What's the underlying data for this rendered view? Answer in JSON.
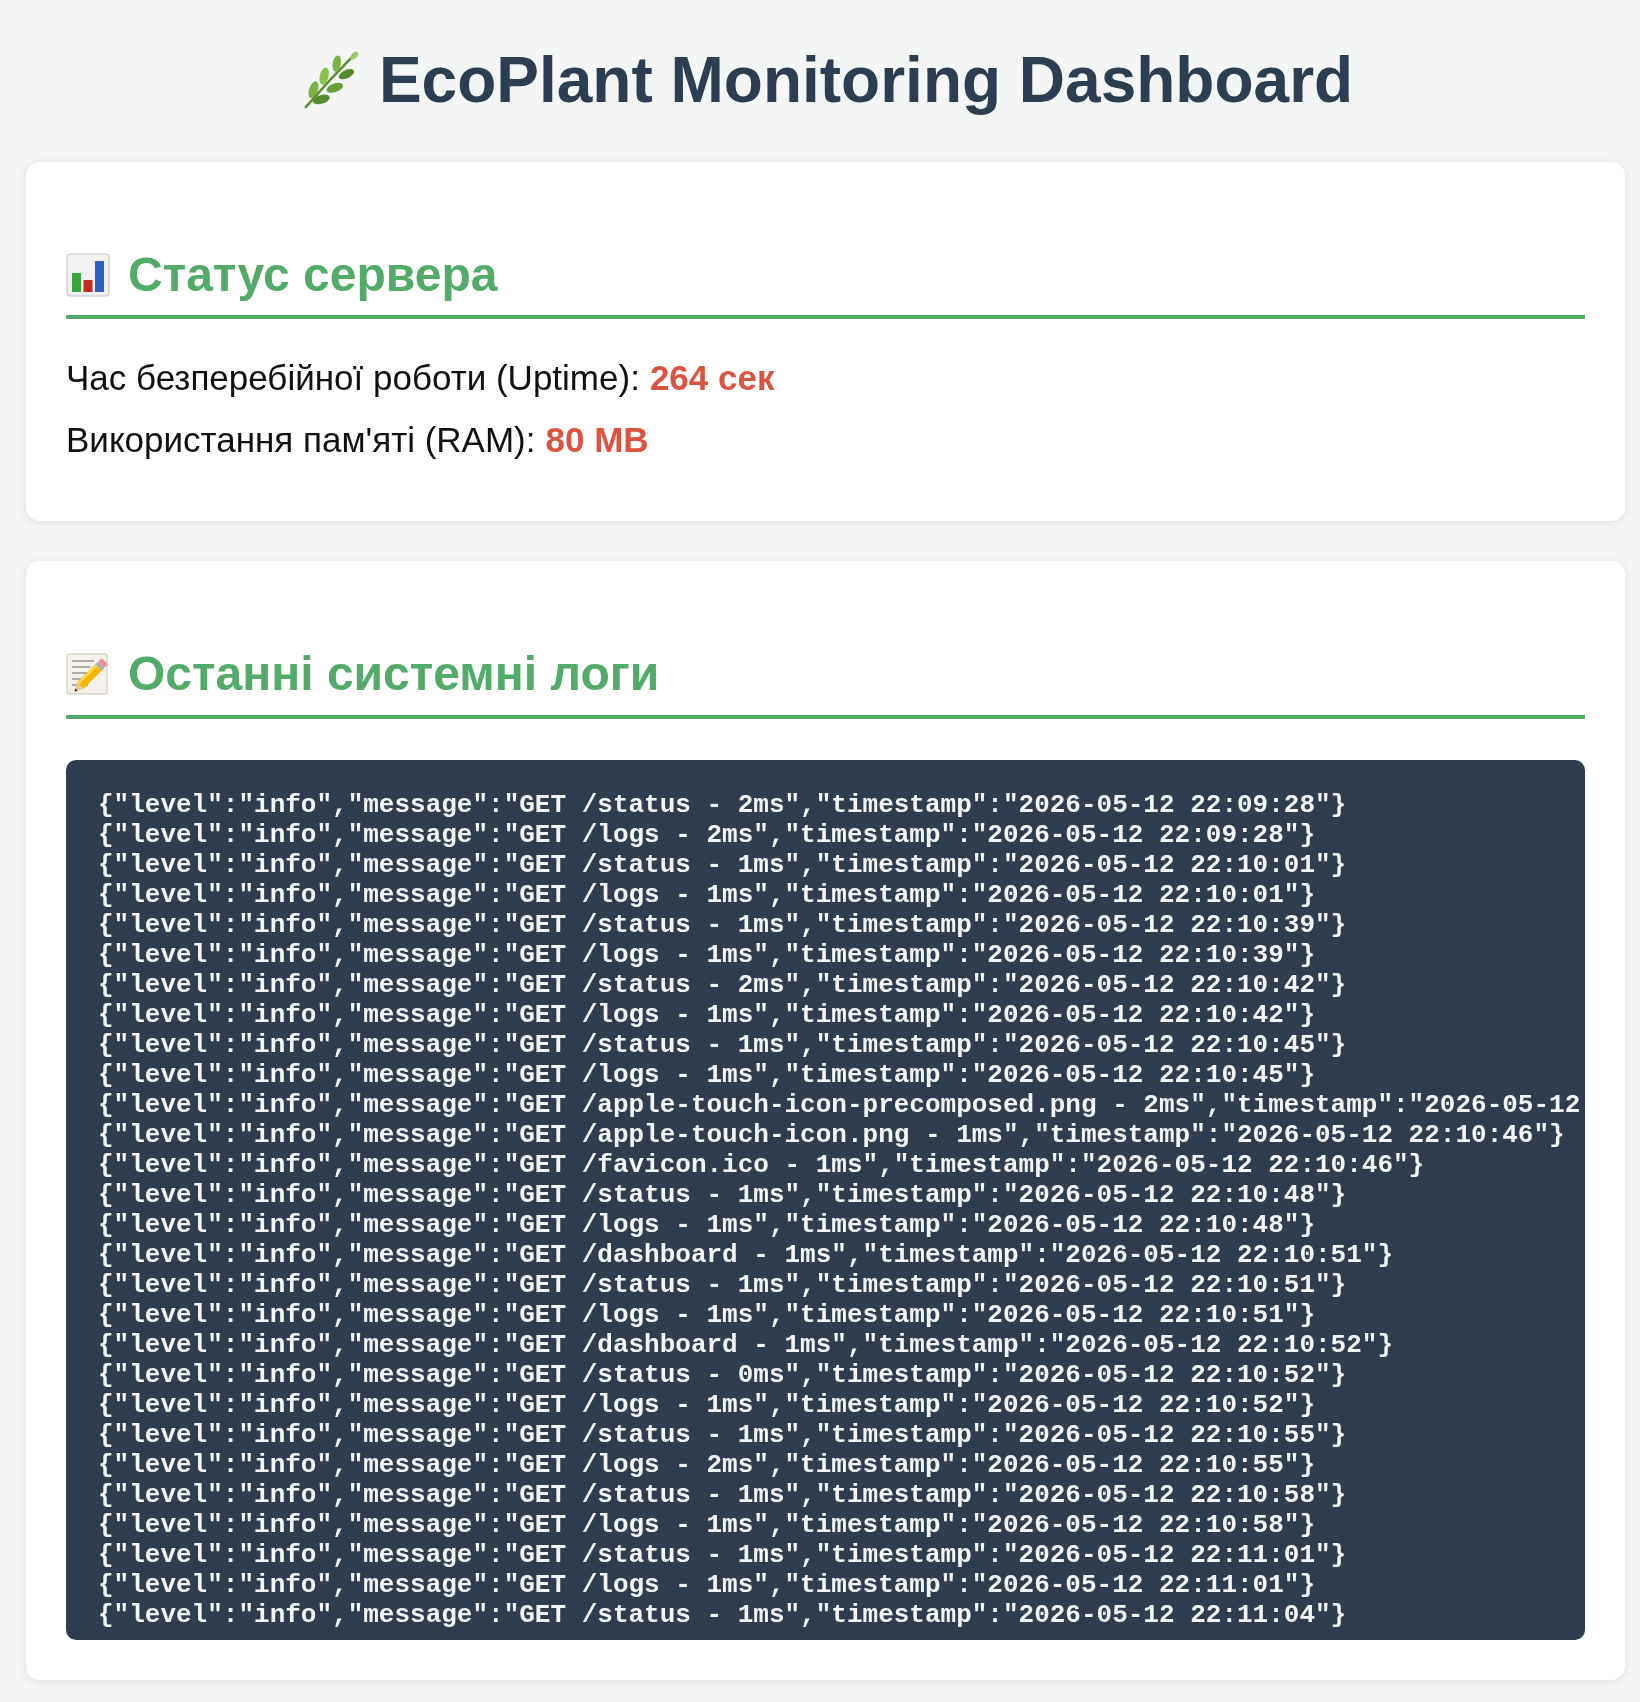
{
  "title": "EcoPlant Monitoring Dashboard",
  "sections": [
    {
      "kind": "metrics",
      "heading": "Статус сервера",
      "metrics": [
        {
          "label": "Час безперебійної роботи (Uptime):",
          "value": "264 сек"
        },
        {
          "label": "Використання пам'яті (RAM):",
          "value": "80 MB"
        }
      ]
    },
    {
      "kind": "log",
      "heading": "Останні системні логи",
      "lines": [
        "{\"level\":\"info\",\"message\":\"GET /status - 2ms\",\"timestamp\":\"2026-05-12 22:09:28\"}",
        "{\"level\":\"info\",\"message\":\"GET /logs - 2ms\",\"timestamp\":\"2026-05-12 22:09:28\"}",
        "{\"level\":\"info\",\"message\":\"GET /status - 1ms\",\"timestamp\":\"2026-05-12 22:10:01\"}",
        "{\"level\":\"info\",\"message\":\"GET /logs - 1ms\",\"timestamp\":\"2026-05-12 22:10:01\"}",
        "{\"level\":\"info\",\"message\":\"GET /status - 1ms\",\"timestamp\":\"2026-05-12 22:10:39\"}",
        "{\"level\":\"info\",\"message\":\"GET /logs - 1ms\",\"timestamp\":\"2026-05-12 22:10:39\"}",
        "{\"level\":\"info\",\"message\":\"GET /status - 2ms\",\"timestamp\":\"2026-05-12 22:10:42\"}",
        "{\"level\":\"info\",\"message\":\"GET /logs - 1ms\",\"timestamp\":\"2026-05-12 22:10:42\"}",
        "{\"level\":\"info\",\"message\":\"GET /status - 1ms\",\"timestamp\":\"2026-05-12 22:10:45\"}",
        "{\"level\":\"info\",\"message\":\"GET /logs - 1ms\",\"timestamp\":\"2026-05-12 22:10:45\"}",
        "{\"level\":\"info\",\"message\":\"GET /apple-touch-icon-precomposed.png - 2ms\",\"timestamp\":\"2026-05-12",
        "{\"level\":\"info\",\"message\":\"GET /apple-touch-icon.png - 1ms\",\"timestamp\":\"2026-05-12 22:10:46\"}",
        "{\"level\":\"info\",\"message\":\"GET /favicon.ico - 1ms\",\"timestamp\":\"2026-05-12 22:10:46\"}",
        "{\"level\":\"info\",\"message\":\"GET /status - 1ms\",\"timestamp\":\"2026-05-12 22:10:48\"}",
        "{\"level\":\"info\",\"message\":\"GET /logs - 1ms\",\"timestamp\":\"2026-05-12 22:10:48\"}",
        "{\"level\":\"info\",\"message\":\"GET /dashboard - 1ms\",\"timestamp\":\"2026-05-12 22:10:51\"}",
        "{\"level\":\"info\",\"message\":\"GET /status - 1ms\",\"timestamp\":\"2026-05-12 22:10:51\"}",
        "{\"level\":\"info\",\"message\":\"GET /logs - 1ms\",\"timestamp\":\"2026-05-12 22:10:51\"}",
        "{\"level\":\"info\",\"message\":\"GET /dashboard - 1ms\",\"timestamp\":\"2026-05-12 22:10:52\"}",
        "{\"level\":\"info\",\"message\":\"GET /status - 0ms\",\"timestamp\":\"2026-05-12 22:10:52\"}",
        "{\"level\":\"info\",\"message\":\"GET /logs - 1ms\",\"timestamp\":\"2026-05-12 22:10:52\"}",
        "{\"level\":\"info\",\"message\":\"GET /status - 1ms\",\"timestamp\":\"2026-05-12 22:10:55\"}",
        "{\"level\":\"info\",\"message\":\"GET /logs - 2ms\",\"timestamp\":\"2026-05-12 22:10:55\"}",
        "{\"level\":\"info\",\"message\":\"GET /status - 1ms\",\"timestamp\":\"2026-05-12 22:10:58\"}",
        "{\"level\":\"info\",\"message\":\"GET /logs - 1ms\",\"timestamp\":\"2026-05-12 22:10:58\"}",
        "{\"level\":\"info\",\"message\":\"GET /status - 1ms\",\"timestamp\":\"2026-05-12 22:11:01\"}",
        "{\"level\":\"info\",\"message\":\"GET /logs - 1ms\",\"timestamp\":\"2026-05-12 22:11:01\"}",
        "{\"level\":\"info\",\"message\":\"GET /status - 1ms\",\"timestamp\":\"2026-05-12 22:11:04\"}"
      ]
    }
  ]
}
